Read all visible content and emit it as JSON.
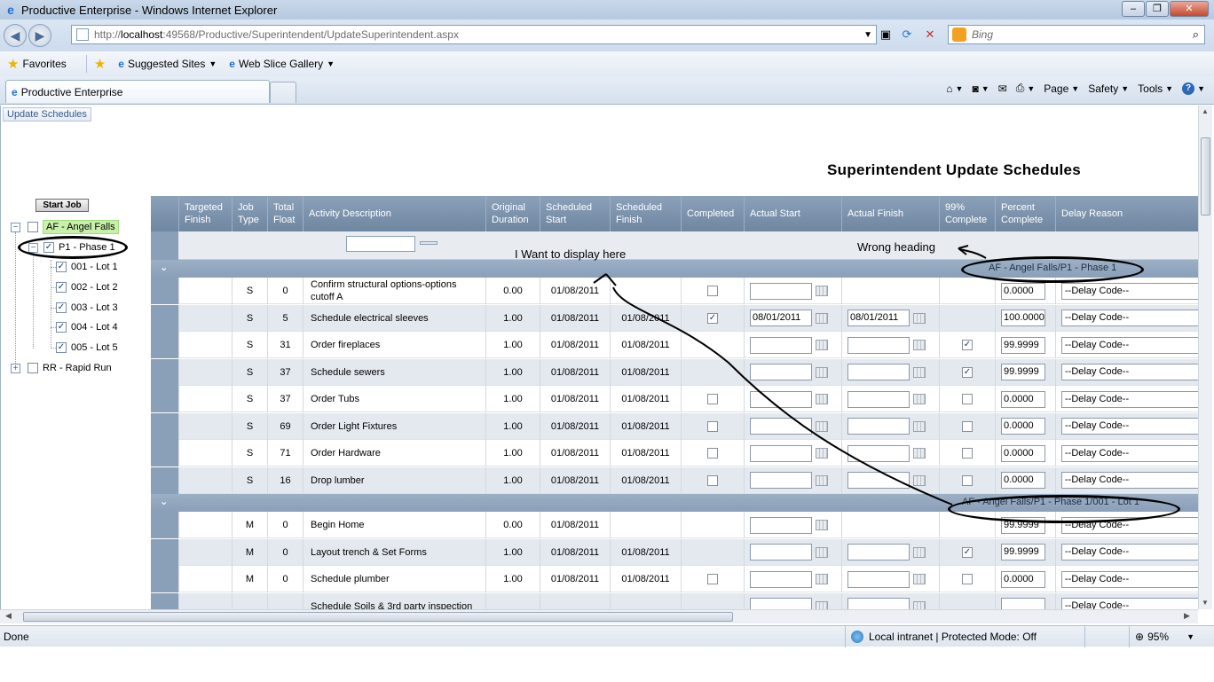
{
  "window": {
    "title": "Productive Enterprise - Windows Internet Explorer",
    "minimize_glyph": "–",
    "maximize_glyph": "❐",
    "close_glyph": "✕"
  },
  "address": {
    "url_prefix": "http://",
    "url_host": "localhost",
    "url_rest": ":49568/Productive/Superintendent/UpdateSuperintendent.aspx",
    "search_placeholder": "Bing"
  },
  "favorites": {
    "favorites_label": "Favorites",
    "suggested_sites_label": "Suggested Sites",
    "web_slice_label": "Web Slice Gallery"
  },
  "tabs": {
    "active_tab_label": "Productive Enterprise"
  },
  "commands": {
    "page_label": "Page",
    "safety_label": "Safety",
    "tools_label": "Tools"
  },
  "status": {
    "done": "Done",
    "zone": "Local intranet | Protected Mode: Off",
    "zoom": "95%"
  },
  "page": {
    "tab_label": "Update Schedules",
    "heading": "Superintendent Update Schedules",
    "start_job_label": "Start Job"
  },
  "tree": {
    "nodes": [
      {
        "label": "AF - Angel Falls",
        "checked": false,
        "expand": "−"
      },
      {
        "label": "P1 - Phase 1",
        "checked": true,
        "expand": "−"
      },
      {
        "label": "001 - Lot 1",
        "checked": true
      },
      {
        "label": "002 - Lot 2",
        "checked": true
      },
      {
        "label": "003 - Lot 3",
        "checked": true
      },
      {
        "label": "004 - Lot 4",
        "checked": true
      },
      {
        "label": "005 - Lot 5",
        "checked": true
      },
      {
        "label": "RR - Rapid Run",
        "checked": false,
        "expand": "+"
      }
    ]
  },
  "grid": {
    "columns": [
      {
        "line1": "Targeted",
        "line2": "Finish"
      },
      {
        "line1": "Job",
        "line2": "Type"
      },
      {
        "line1": "Total",
        "line2": "Float"
      },
      {
        "line1": "Activity Description",
        "line2": ""
      },
      {
        "line1": "Original",
        "line2": "Duration"
      },
      {
        "line1": "Scheduled",
        "line2": "Start"
      },
      {
        "line1": "Scheduled",
        "line2": "Finish"
      },
      {
        "line1": "Completed",
        "line2": ""
      },
      {
        "line1": "Actual Start",
        "line2": ""
      },
      {
        "line1": "Actual Finish",
        "line2": ""
      },
      {
        "line1": "99%",
        "line2": "Complete"
      },
      {
        "line1": "Percent",
        "line2": "Complete"
      },
      {
        "line1": "Delay Reason",
        "line2": ""
      }
    ],
    "group1_label": "AF - Angel Falls/P1 - Phase 1",
    "group2_label": "AF - Angel Falls/P1 - Phase 1/001 - Lot 1",
    "group_caret": "⌄",
    "delay_placeholder": "--Delay Code--",
    "rows_group1": [
      {
        "type": "S",
        "float": "0",
        "desc1": "Confirm structural options-options",
        "desc2": "cutoff A",
        "dur": "0.00",
        "start": "01/08/2011",
        "finish": "",
        "completed": "☐",
        "astart": "",
        "afinish": "",
        "has_afinish": false,
        "c99": "",
        "pct": "0.0000"
      },
      {
        "type": "S",
        "float": "5",
        "desc1": "Schedule electrical sleeves",
        "desc2": "",
        "dur": "1.00",
        "start": "01/08/2011",
        "finish": "01/08/2011",
        "completed": "☑",
        "astart": "08/01/2011",
        "afinish": "08/01/2011",
        "has_afinish": true,
        "c99": "",
        "pct": "100.0000"
      },
      {
        "type": "S",
        "float": "31",
        "desc1": "Order fireplaces",
        "desc2": "",
        "dur": "1.00",
        "start": "01/08/2011",
        "finish": "01/08/2011",
        "completed": "",
        "astart": "",
        "afinish": "",
        "has_afinish": true,
        "c99": "☑",
        "pct": "99.9999"
      },
      {
        "type": "S",
        "float": "37",
        "desc1": "Schedule sewers",
        "desc2": "",
        "dur": "1.00",
        "start": "01/08/2011",
        "finish": "01/08/2011",
        "completed": "",
        "astart": "",
        "afinish": "",
        "has_afinish": true,
        "c99": "☑",
        "pct": "99.9999"
      },
      {
        "type": "S",
        "float": "37",
        "desc1": "Order Tubs",
        "desc2": "",
        "dur": "1.00",
        "start": "01/08/2011",
        "finish": "01/08/2011",
        "completed": "☐",
        "astart": "",
        "afinish": "",
        "has_afinish": true,
        "c99": "☐",
        "pct": "0.0000"
      },
      {
        "type": "S",
        "float": "69",
        "desc1": "Order Light Fixtures",
        "desc2": "",
        "dur": "1.00",
        "start": "01/08/2011",
        "finish": "01/08/2011",
        "completed": "☐",
        "astart": "",
        "afinish": "",
        "has_afinish": true,
        "c99": "☐",
        "pct": "0.0000"
      },
      {
        "type": "S",
        "float": "71",
        "desc1": "Order Hardware",
        "desc2": "",
        "dur": "1.00",
        "start": "01/08/2011",
        "finish": "01/08/2011",
        "completed": "☐",
        "astart": "",
        "afinish": "",
        "has_afinish": true,
        "c99": "☐",
        "pct": "0.0000"
      },
      {
        "type": "S",
        "float": "16",
        "desc1": "Drop lumber",
        "desc2": "",
        "dur": "1.00",
        "start": "01/08/2011",
        "finish": "01/08/2011",
        "completed": "☐",
        "astart": "",
        "afinish": "",
        "has_afinish": true,
        "c99": "☐",
        "pct": "0.0000"
      }
    ],
    "rows_group2": [
      {
        "type": "M",
        "float": "0",
        "desc1": "Begin Home",
        "desc2": "",
        "dur": "0.00",
        "start": "01/08/2011",
        "finish": "",
        "completed": "",
        "astart": "",
        "afinish": "",
        "has_afinish": false,
        "c99": "",
        "pct": "99.9999"
      },
      {
        "type": "M",
        "float": "0",
        "desc1": "Layout trench & Set Forms",
        "desc2": "",
        "dur": "1.00",
        "start": "01/08/2011",
        "finish": "01/08/2011",
        "completed": "",
        "astart": "",
        "afinish": "",
        "has_afinish": true,
        "c99": "☑",
        "pct": "99.9999"
      },
      {
        "type": "M",
        "float": "0",
        "desc1": "Schedule plumber",
        "desc2": "",
        "dur": "1.00",
        "start": "01/08/2011",
        "finish": "01/08/2011",
        "completed": "☐",
        "astart": "",
        "afinish": "",
        "has_afinish": true,
        "c99": "☐",
        "pct": "0.0000"
      },
      {
        "type": "",
        "float": "",
        "desc1": "Schedule Soils & 3rd party inspection",
        "desc2": "",
        "dur": "",
        "start": "",
        "finish": "",
        "completed": "",
        "astart": "",
        "afinish": "",
        "has_afinish": true,
        "c99": "",
        "pct": ""
      }
    ]
  },
  "annotations": {
    "display_here": "I Want to display here",
    "wrong_heading": "Wrong heading"
  }
}
